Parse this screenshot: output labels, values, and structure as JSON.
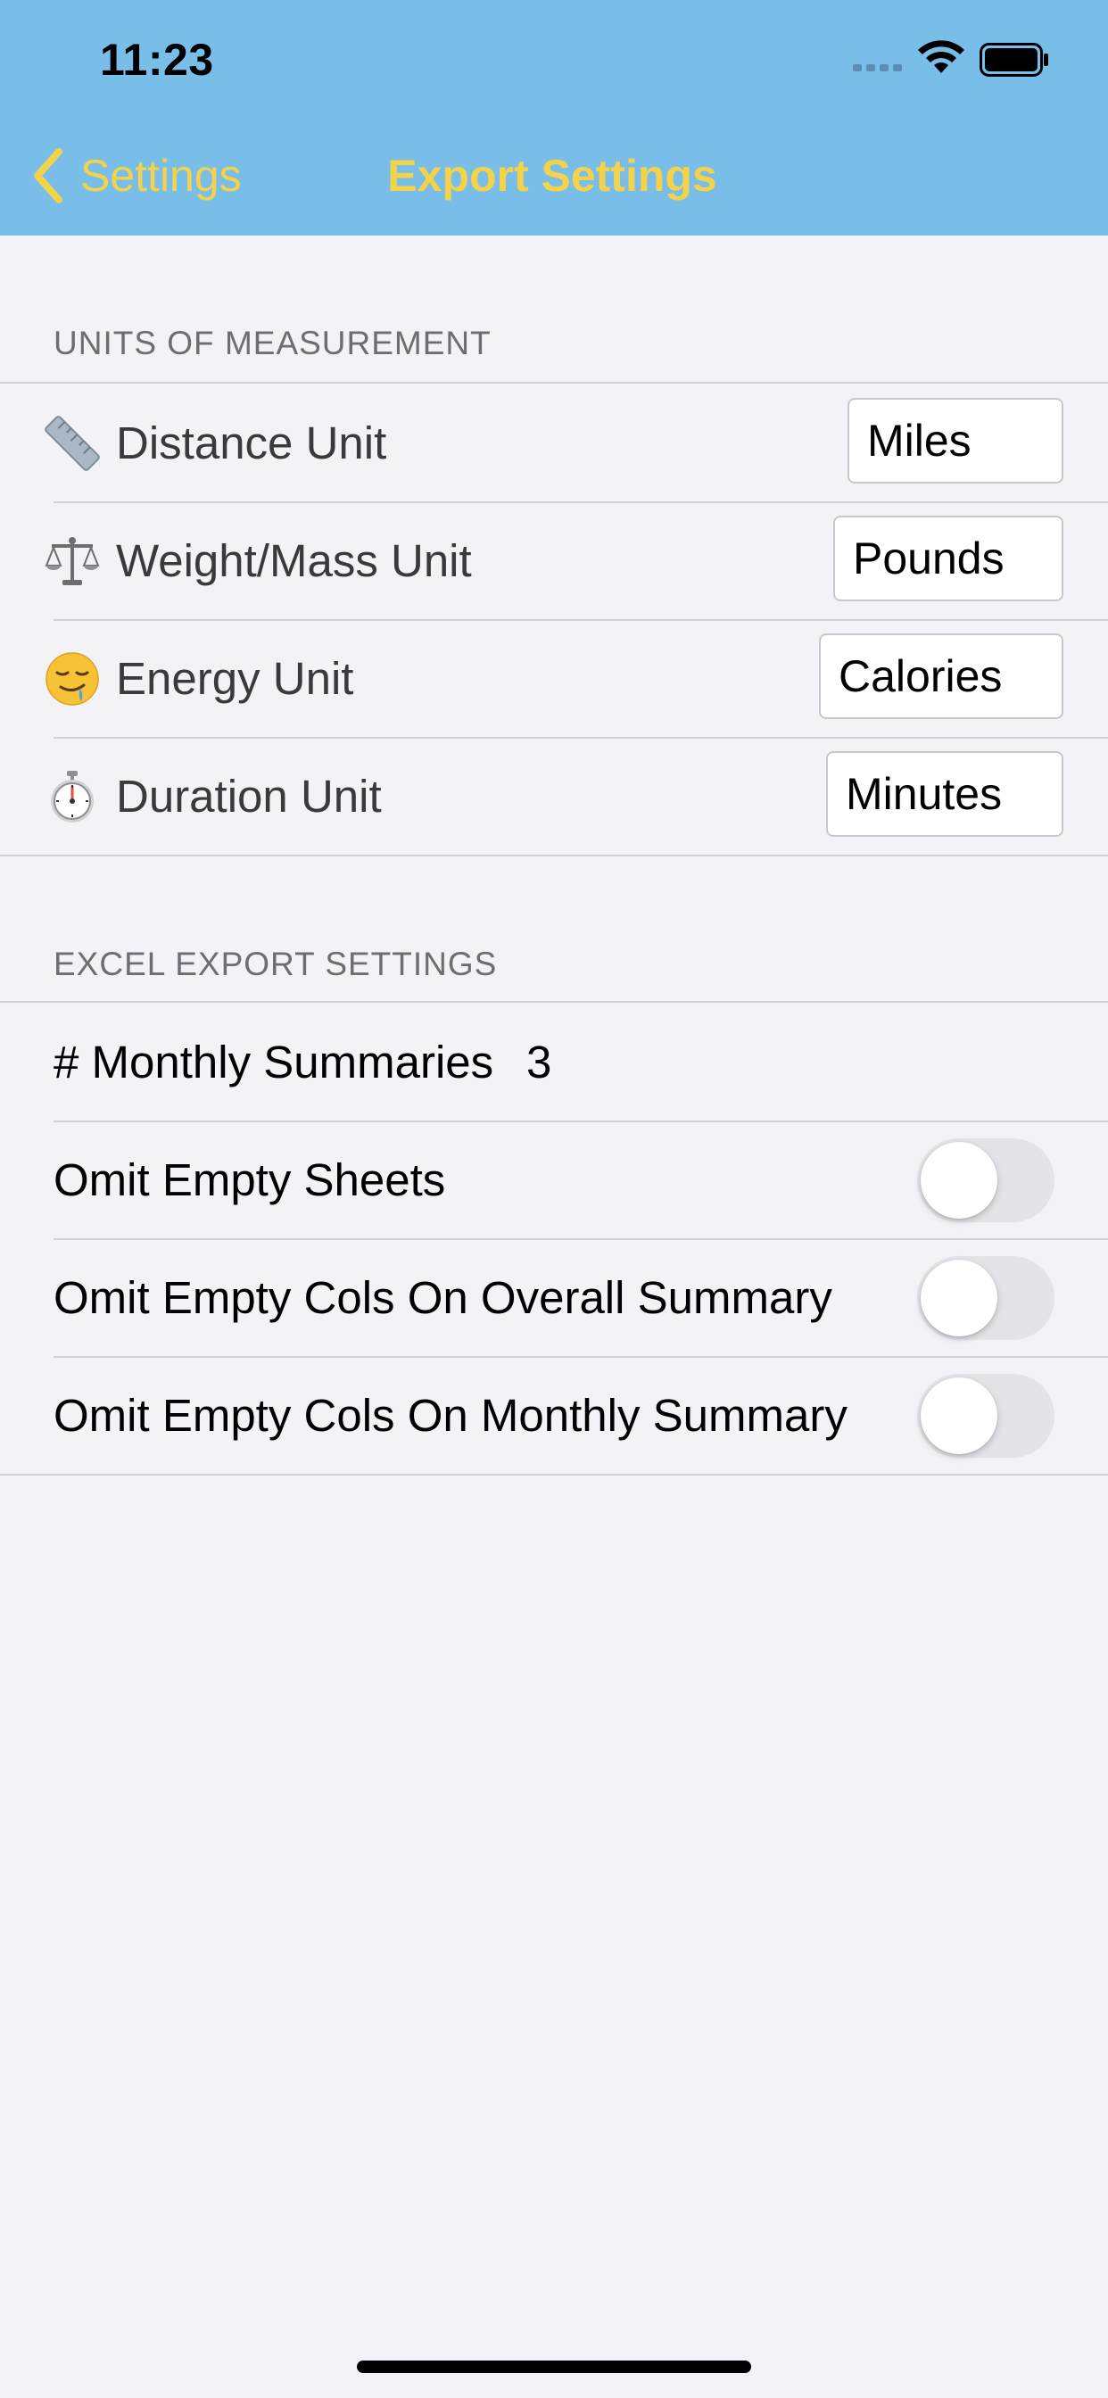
{
  "status_bar": {
    "time": "11:23"
  },
  "nav": {
    "back_label": "Settings",
    "title": "Export Settings"
  },
  "units_section": {
    "header": "UNITS OF MEASUREMENT",
    "rows": [
      {
        "label": "Distance Unit",
        "value": "Miles",
        "icon": "ruler-icon"
      },
      {
        "label": "Weight/Mass Unit",
        "value": "Pounds",
        "icon": "scales-icon"
      },
      {
        "label": "Energy Unit",
        "value": "Calories",
        "icon": "drooling-face-icon"
      },
      {
        "label": "Duration Unit",
        "value": "Minutes",
        "icon": "stopwatch-icon"
      }
    ]
  },
  "excel_section": {
    "header": "EXCEL EXPORT SETTINGS",
    "monthly_summaries_label": "# Monthly Summaries",
    "monthly_summaries_value": "3",
    "toggles": [
      {
        "label": "Omit Empty Sheets",
        "on": false
      },
      {
        "label": "Omit Empty Cols On Overall Summary",
        "on": false
      },
      {
        "label": "Omit Empty Cols On Monthly Summary",
        "on": false
      }
    ]
  },
  "colors": {
    "nav_background": "#78bee9",
    "nav_accent": "#f4d24a",
    "page_background": "#f2f2f7",
    "toggle_off": "#e3e3e8"
  }
}
